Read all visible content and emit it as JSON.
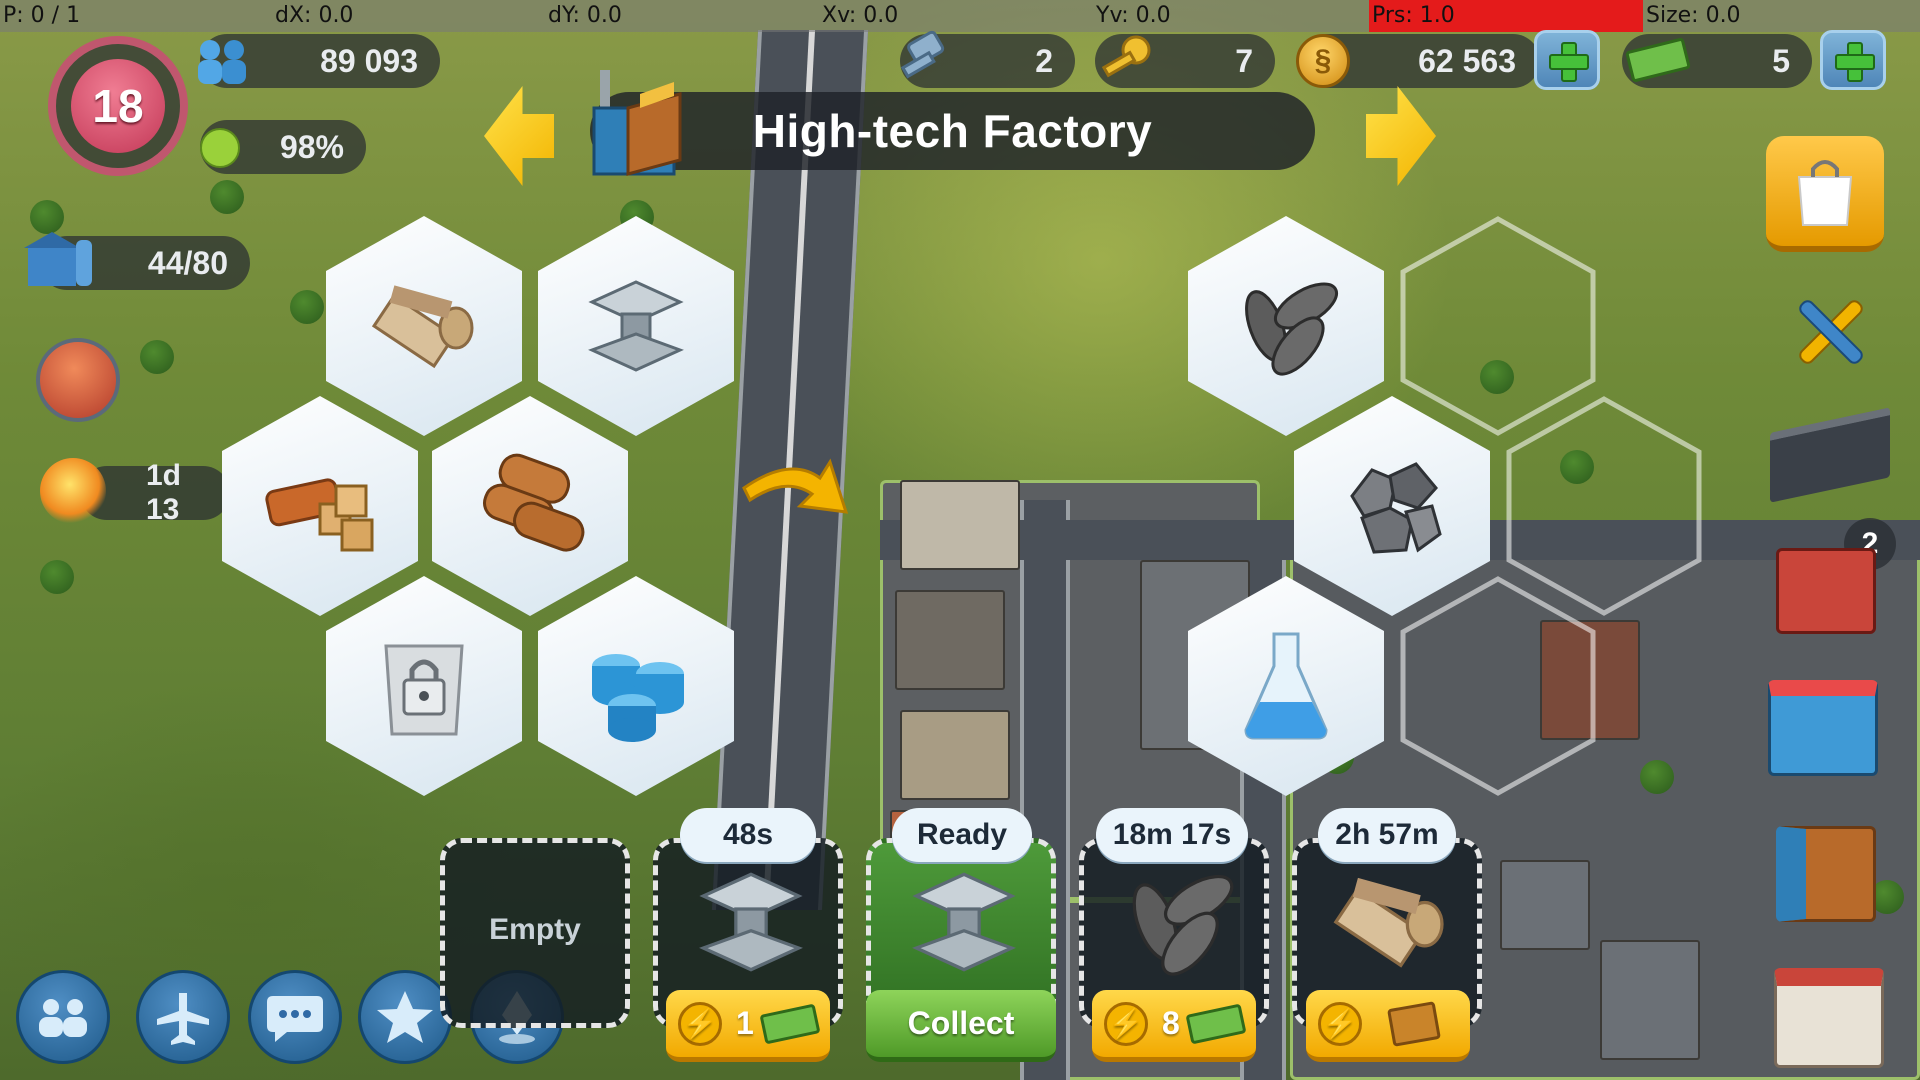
{
  "debug": {
    "p": "P: 0 / 1",
    "dx": "dX: 0.0",
    "dy": "dY: 0.0",
    "xv": "Xv: 0.0",
    "yv": "Yv: 0.0",
    "prs": "Prs: 1.0",
    "size": "Size: 0.0"
  },
  "stats": {
    "level": "18",
    "population": "89 093",
    "happiness": "98%",
    "storage": "44/80",
    "timer_event": "1d 13"
  },
  "currencies": {
    "keys_blue": "2",
    "keys_gold": "7",
    "simoleons": "62 563",
    "simcash": "5"
  },
  "title": "High-tech Factory",
  "right_badge": "2",
  "hex_left": [
    "textiles-icon",
    "metal-icon",
    "wood-products-icon",
    "wood-icon",
    "locked-slot-icon",
    "plastic-icon"
  ],
  "hex_right": [
    "seeds-icon",
    "minerals-icon",
    "chemicals-icon"
  ],
  "slots": [
    {
      "state": "empty",
      "label": "Empty"
    },
    {
      "timer": "48s",
      "speedup_cost": "1",
      "item": "metal"
    },
    {
      "timer": "Ready",
      "action": "Collect",
      "item": "metal"
    },
    {
      "timer": "18m 17s",
      "speedup_cost": "8",
      "item": "seeds"
    },
    {
      "timer": "2h 57m",
      "item": "textiles",
      "speedup": "video-icon"
    }
  ],
  "colors": {
    "accent_yellow": "#f2b400",
    "prs_red": "#e41b1b",
    "ready_green": "#4f9a28"
  }
}
